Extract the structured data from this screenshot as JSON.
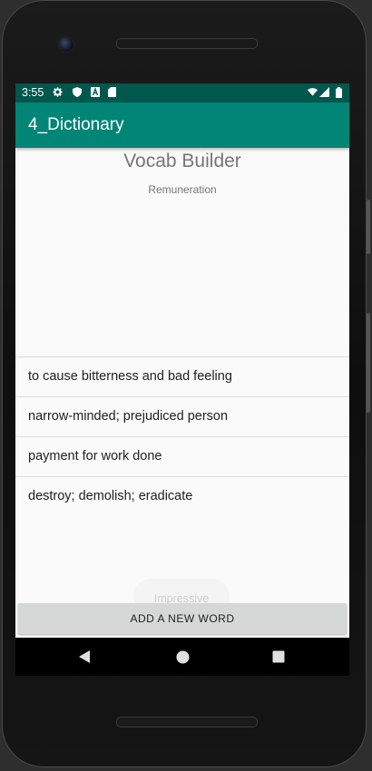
{
  "statusbar": {
    "time": "3:55",
    "icons": [
      "settings-icon",
      "shield-icon",
      "a-icon",
      "sd-card-icon",
      "wifi-icon",
      "signal-icon",
      "battery-icon"
    ]
  },
  "toolbar": {
    "title": "4_Dictionary"
  },
  "main": {
    "app_title": "Vocab Builder",
    "current_word": "Remuneration",
    "definitions": [
      "to cause bitterness and bad feeling",
      "narrow-minded; prejudiced person",
      "payment for work done",
      "destroy; demolish; eradicate"
    ],
    "toast": "Impressive",
    "add_button": "ADD A NEW WORD"
  },
  "navbar": {
    "buttons": [
      "back-icon",
      "home-icon",
      "recents-icon"
    ]
  },
  "colors": {
    "statusbar": "#00574b",
    "toolbar": "#008577",
    "background": "#fafafa",
    "button": "#d6d7d7"
  }
}
